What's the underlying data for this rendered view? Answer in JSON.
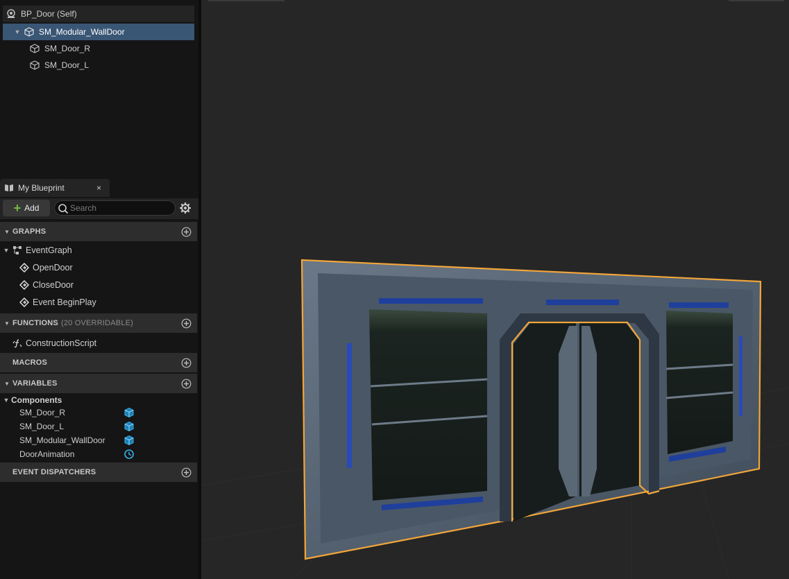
{
  "components": {
    "root": {
      "label": "BP_Door (Self)",
      "icon": "actor-icon"
    },
    "items": [
      {
        "label": "SM_Modular_WallDoor",
        "icon": "static-mesh-icon",
        "selected": true,
        "expanded": true
      },
      {
        "label": "SM_Door_R",
        "icon": "static-mesh-icon"
      },
      {
        "label": "SM_Door_L",
        "icon": "static-mesh-icon"
      }
    ]
  },
  "my_blueprint": {
    "tab_label": "My Blueprint",
    "close_glyph": "×",
    "add_label": "Add",
    "search_placeholder": "Search",
    "sections": {
      "graphs": {
        "label": "GRAPHS"
      },
      "functions": {
        "label": "FUNCTIONS",
        "extra": "(20 OVERRIDABLE)"
      },
      "macros": {
        "label": "MACROS"
      },
      "variables": {
        "label": "VARIABLES"
      },
      "event_dispatchers": {
        "label": "EVENT DISPATCHERS"
      }
    },
    "graphs": {
      "event_graph": "EventGraph",
      "events": [
        "OpenDoor",
        "CloseDoor",
        "Event BeginPlay"
      ]
    },
    "functions": [
      "ConstructionScript"
    ],
    "variables": {
      "category": "Components",
      "items": [
        {
          "label": "SM_Door_R",
          "type_icon": "static-mesh-type-icon"
        },
        {
          "label": "SM_Door_L",
          "type_icon": "static-mesh-type-icon"
        },
        {
          "label": "SM_Modular_WallDoor",
          "type_icon": "static-mesh-type-icon"
        },
        {
          "label": "DoorAnimation",
          "type_icon": "timeline-type-icon"
        }
      ]
    }
  },
  "colors": {
    "selection_outline": "#f2a63a",
    "selected_row": "#3a5675",
    "accent_blue": "#29a8e0",
    "add_green": "#6fbd47"
  }
}
